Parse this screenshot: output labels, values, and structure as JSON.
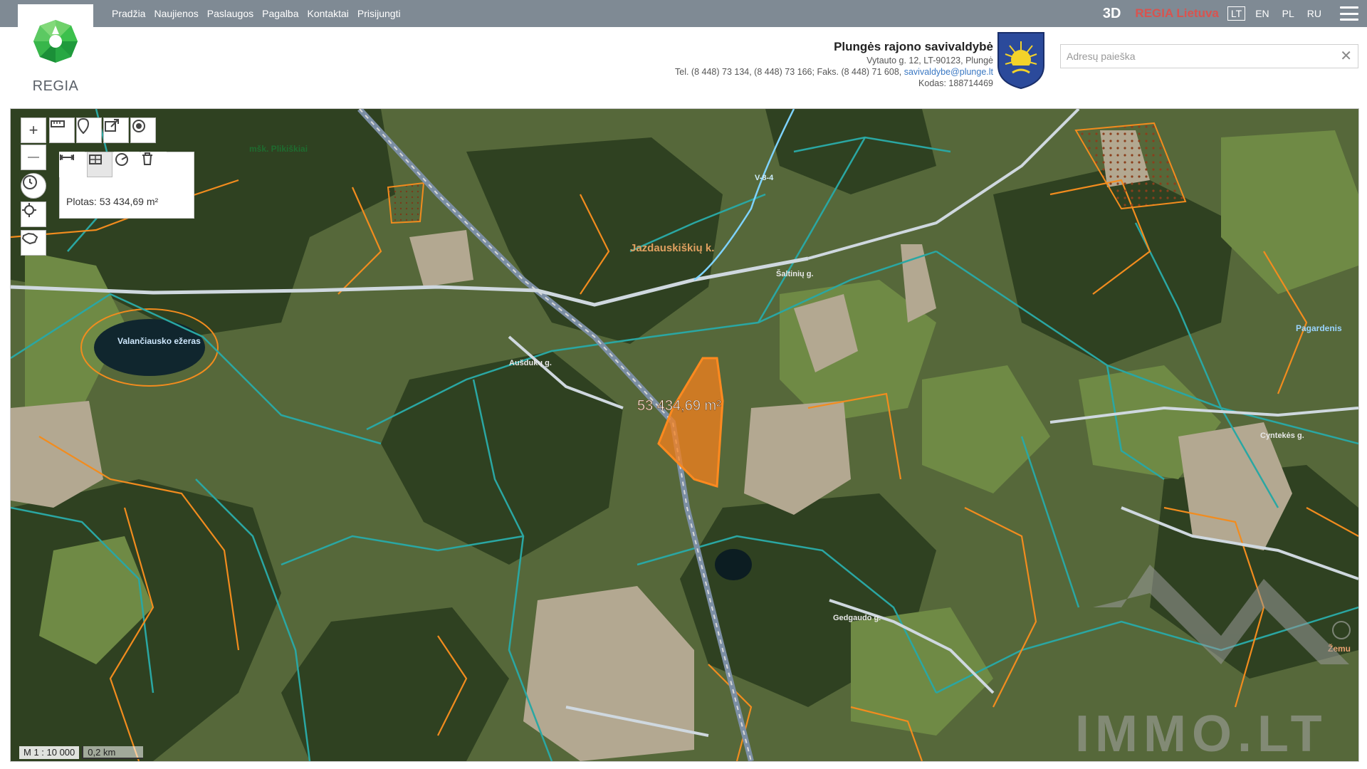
{
  "nav": {
    "items": [
      "Pradžia",
      "Naujienos",
      "Paslaugos",
      "Pagalba",
      "Kontaktai",
      "Prisijungti"
    ],
    "btn3d": "3D",
    "regia_lt": "REGIA Lietuva",
    "languages": [
      "LT",
      "EN",
      "PL",
      "RU"
    ],
    "active_language": "LT"
  },
  "logo": {
    "text": "REGIA"
  },
  "municipality": {
    "title": "Plungės rajono savivaldybė",
    "address": "Vytauto g. 12, LT-90123, Plungė",
    "phones": "Tel. (8 448) 73 134, (8 448) 73 166; Faks. (8 448) 71 608, ",
    "email": "savivaldybe@plunge.lt",
    "code": "Kodas: 188714469"
  },
  "search": {
    "placeholder": "Adresų paieška",
    "value": "",
    "clear": "✕"
  },
  "tools": {
    "zoom_in": "+",
    "zoom_out": "—",
    "area_readout": "Plotas: 53 434,69 m²"
  },
  "map": {
    "labels": {
      "forest": "mšk. Plikiškiai",
      "village": "Jazdauskiškių k.",
      "lake": "Valančiausko ežeras",
      "road_sakiniai": "Šaltinių g.",
      "road_ausdukai": "Aušdukų g.",
      "road_pagardenis": "Pagardenis",
      "road_cyntekes": "Cyntekės g.",
      "road_gedgaudo": "Gedgaudo g.",
      "road_zemu": "Žemu",
      "road_v8": "V-8-4"
    },
    "measure": "53 434,69 m²",
    "scale_ratio": "M 1 : 10 000",
    "scale_bar": "0,2 km",
    "watermark": "IMMO.LT",
    "colors": {
      "cadastre_orange": "#f28c1e",
      "cadastre_teal": "#2aa7a3",
      "highlight": "#f5801e"
    }
  }
}
